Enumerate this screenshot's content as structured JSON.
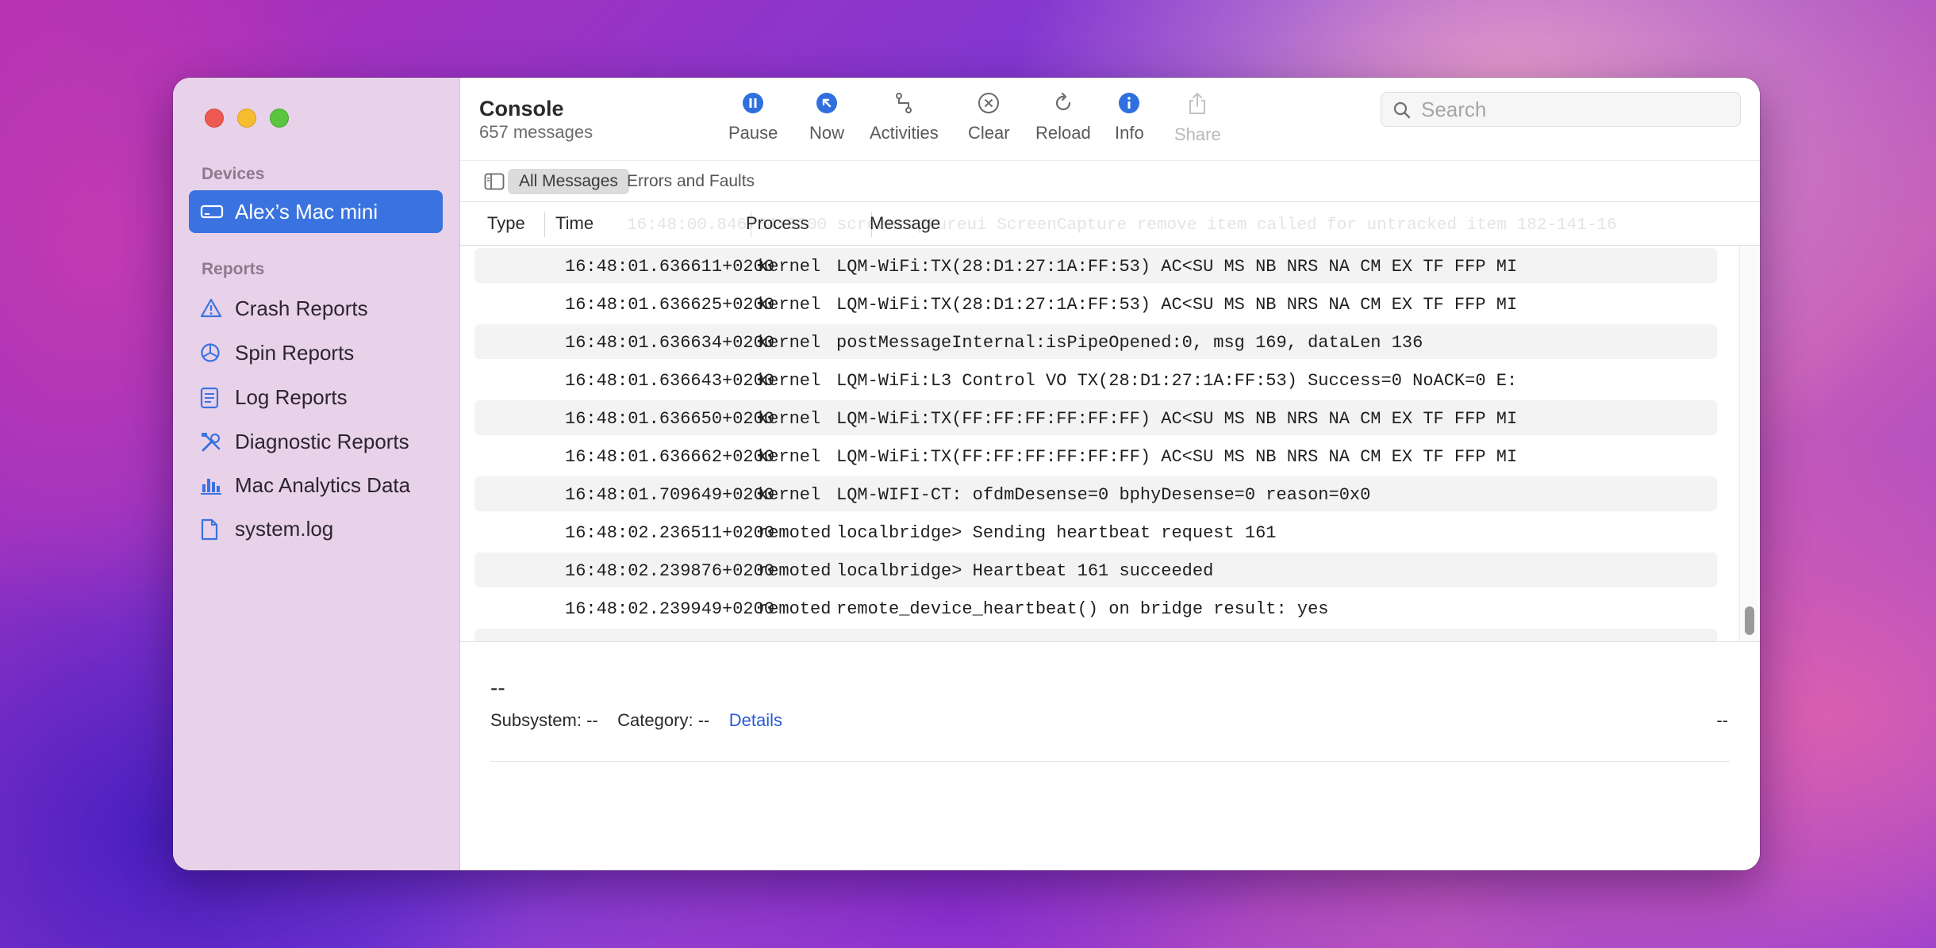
{
  "window": {
    "title": "Console",
    "subtitle": "657 messages"
  },
  "sidebar": {
    "devices_header": "Devices",
    "device": "Alex’s Mac mini",
    "reports_header": "Reports",
    "items": [
      {
        "label": "Crash Reports",
        "icon": "warning-triangle-icon"
      },
      {
        "label": "Spin Reports",
        "icon": "spin-wheel-icon"
      },
      {
        "label": "Log Reports",
        "icon": "log-document-icon"
      },
      {
        "label": "Diagnostic Reports",
        "icon": "tools-icon"
      },
      {
        "label": "Mac Analytics Data",
        "icon": "bar-chart-icon"
      },
      {
        "label": "system.log",
        "icon": "document-icon"
      }
    ]
  },
  "toolbar": {
    "pause": "Pause",
    "now": "Now",
    "activities": "Activities",
    "clear": "Clear",
    "reload": "Reload",
    "info": "Info",
    "share": "Share",
    "accent": "#2f6fe0"
  },
  "search": {
    "placeholder": "Search"
  },
  "filters": {
    "all": "All Messages",
    "errors": "Errors and Faults"
  },
  "columns": {
    "type": "Type",
    "time": "Time",
    "process": "Process",
    "message": "Message",
    "ghost_row": "16:48:00.846784+0200 screencaptureui ScreenCapture remove item called for untracked item 182-141-16"
  },
  "rows": [
    {
      "time": "16:48:01.636611+0200",
      "process": "kernel",
      "message": "LQM-WiFi:TX(28:D1:27:1A:FF:53) AC<SU MS NB NRS NA CM EX TF FFP MI"
    },
    {
      "time": "16:48:01.636625+0200",
      "process": "kernel",
      "message": "LQM-WiFi:TX(28:D1:27:1A:FF:53) AC<SU MS NB NRS NA CM EX TF FFP MI"
    },
    {
      "time": "16:48:01.636634+0200",
      "process": "kernel",
      "message": "postMessageInternal:isPipeOpened:0, msg 169, dataLen 136"
    },
    {
      "time": "16:48:01.636643+0200",
      "process": "kernel",
      "message": "LQM-WiFi:L3 Control VO TX(28:D1:27:1A:FF:53) Success=0 NoACK=0 E:"
    },
    {
      "time": "16:48:01.636650+0200",
      "process": "kernel",
      "message": "LQM-WiFi:TX(FF:FF:FF:FF:FF:FF) AC<SU MS NB NRS NA CM EX TF FFP MI"
    },
    {
      "time": "16:48:01.636662+0200",
      "process": "kernel",
      "message": "LQM-WiFi:TX(FF:FF:FF:FF:FF:FF) AC<SU MS NB NRS NA CM EX TF FFP MI"
    },
    {
      "time": "16:48:01.709649+0200",
      "process": "kernel",
      "message": "LQM-WIFI-CT: ofdmDesense=0 bphyDesense=0 reason=0x0"
    },
    {
      "time": "16:48:02.236511+0200",
      "process": "remoted",
      "message": "localbridge> Sending heartbeat request 161"
    },
    {
      "time": "16:48:02.239876+0200",
      "process": "remoted",
      "message": "localbridge> Heartbeat 161 succeeded"
    },
    {
      "time": "16:48:02.239949+0200",
      "process": "remoted",
      "message": "remote_device_heartbeat() on bridge result: yes"
    }
  ],
  "detail": {
    "title": "--",
    "subsystem_label": "Subsystem:",
    "subsystem_value": "--",
    "category_label": "Category:",
    "category_value": "--",
    "details_link": "Details",
    "right_value": "--"
  }
}
